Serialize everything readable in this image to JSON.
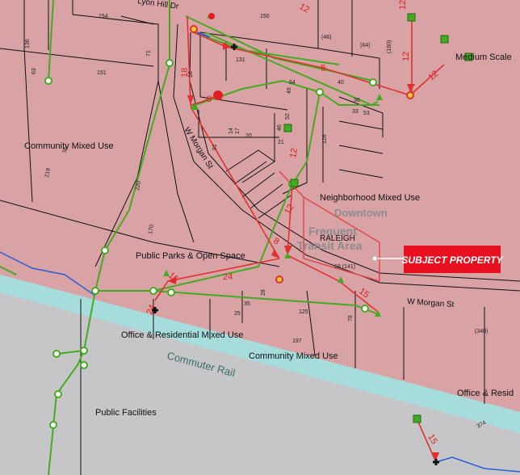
{
  "colors": {
    "zone_pink": "#d9a3a6",
    "rail_cyan": "#a6dcdc",
    "rail_gray": "#c6c6c8",
    "callout_red": "#e8101e",
    "sewer_green": "#44aa22",
    "flow_red": "#e03030",
    "water_blue": "#2a5fd6",
    "transit_outline": "#e0484c"
  },
  "zones": {
    "community_mixed_use_1": "Community Mixed Use",
    "neighborhood_mixed_use": "Neighborhood Mixed Use",
    "downtown": "Downtown",
    "public_parks": "Public Parks & Open Space",
    "office_residential": "Office & Residential Mixed Use",
    "community_mixed_use_2": "Community Mixed Use",
    "office_resid_right": "Office & Resid",
    "public_facilities": "Public Facilities",
    "medium_scale": "Medium Scale"
  },
  "overlay": {
    "line1": "Frequent",
    "line2": "Transit Area",
    "raleigh": "RALEIGH"
  },
  "callout": {
    "label": "SUBJECT PROPERTY"
  },
  "streets": {
    "w_morgan_diag": "W Morgan St",
    "w_morgan_horiz": "W Morgan St",
    "lyon_hill": "Lyon Hill Dr",
    "commuter_rail": "Commuter Rail"
  },
  "parcel_numbers": [
    "154",
    "150",
    "(46)",
    "(64)",
    "(180)",
    "131",
    "136",
    "151",
    "64",
    "40",
    "36",
    "53",
    "33",
    "49",
    "52",
    "91",
    "20",
    "17",
    "14",
    "18",
    "78",
    "(340)",
    "197",
    "125",
    "19 (141)",
    "35",
    "25",
    "28",
    "374",
    "220",
    "219",
    "126",
    "46",
    "21",
    "170",
    "71",
    "75",
    "63"
  ],
  "pipe_sizes": [
    "18",
    "12",
    "12",
    "12",
    "8",
    "12",
    "8",
    "12",
    "24",
    "15",
    "15",
    "24",
    "15",
    "8",
    "12"
  ],
  "icons": {
    "sewer_node": "sewer-node-icon",
    "manhole": "manhole-icon",
    "cleanout": "cleanout-icon",
    "hydrant": "hydrant-icon",
    "flow_arrow": "flow-arrow-icon"
  }
}
